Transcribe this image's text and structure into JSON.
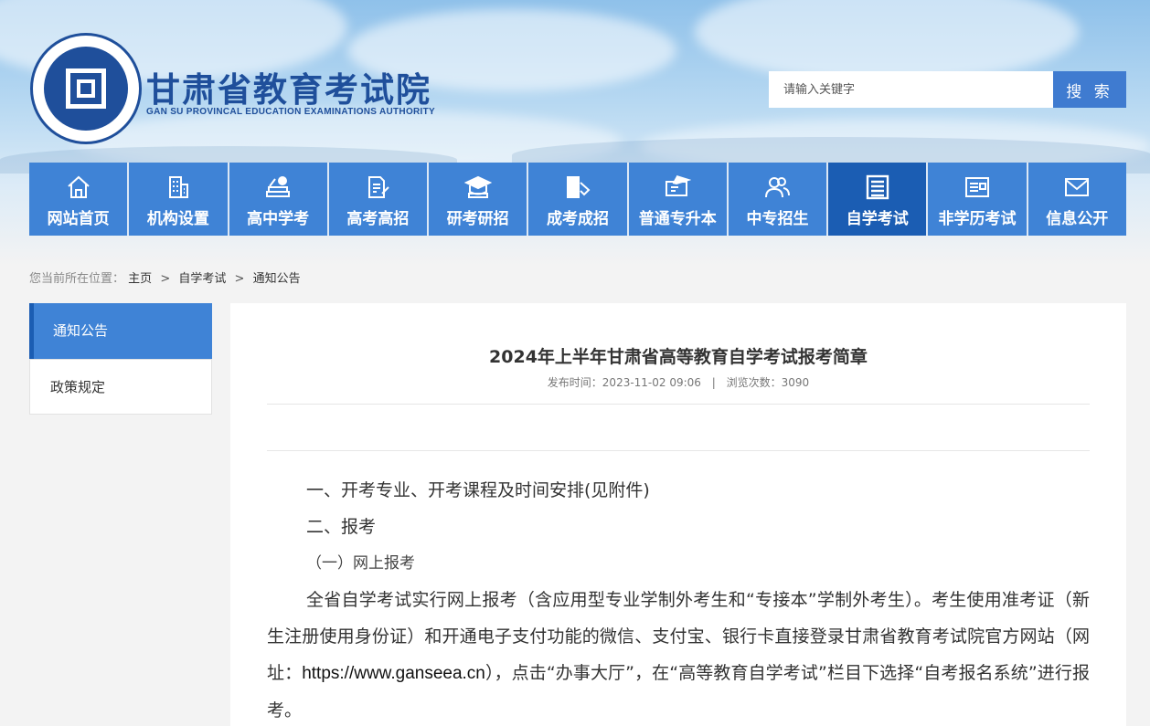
{
  "header": {
    "title": "甘肃省教育考试院",
    "subtitle": "GAN SU PROVINCAL EDUCATION EXAMINATIONS AUTHORITY",
    "search_placeholder": "请输入关键字",
    "search_button": "搜 索",
    "logo_icon": "seal-logo-icon",
    "brand_color": "#1f4f9b"
  },
  "nav": {
    "items": [
      {
        "label": "网站首页",
        "icon": "home-icon"
      },
      {
        "label": "机构设置",
        "icon": "building-icon"
      },
      {
        "label": "高中学考",
        "icon": "books-icon"
      },
      {
        "label": "高考高招",
        "icon": "pen-paper-icon"
      },
      {
        "label": "研考研招",
        "icon": "graduation-cap-icon"
      },
      {
        "label": "成考成招",
        "icon": "book-pencil-icon"
      },
      {
        "label": "普通专升本",
        "icon": "monitor-cap-icon"
      },
      {
        "label": "中专招生",
        "icon": "users-icon"
      },
      {
        "label": "自学考试",
        "icon": "document-list-icon"
      },
      {
        "label": "非学历考试",
        "icon": "id-card-icon"
      },
      {
        "label": "信息公开",
        "icon": "mail-icon"
      }
    ],
    "active_index": 8,
    "color": "#3f83d6",
    "active_color": "#1b5db3"
  },
  "breadcrumb": {
    "prefix": "您当前所在位置：",
    "items": [
      "主页",
      "自学考试",
      "通知公告"
    ],
    "separator": ">"
  },
  "sidebar": {
    "items": [
      "通知公告",
      "政策规定"
    ],
    "active_index": 0
  },
  "article": {
    "title": "2024年上半年甘肃省高等教育自学考试报考简章",
    "meta_time_label": "发布时间：",
    "meta_time": "2023-11-02 09:06",
    "meta_divider": "|",
    "meta_views_label": "浏览次数：",
    "meta_views": "3090",
    "section1": "一、开考专业、开考课程及时间安排(见附件)",
    "section2": "二、报考",
    "subsection1": "（一）网上报考",
    "para_part1": "全省自学考试实行网上报考（含应用型专业学制外考生和“专接本”学制外考生）。考生使用准考证（新生注册使用身份证）和开通电子支付功能的微信、支付宝、银行卡直接登录甘肃省教育考试院官方网站（网址：",
    "para_url": "https://www.ganseea.cn",
    "para_part2": "），点击“办事大厅”，在“高等教育自学考试”栏目下选择“自考报名系统”进行报考。"
  }
}
